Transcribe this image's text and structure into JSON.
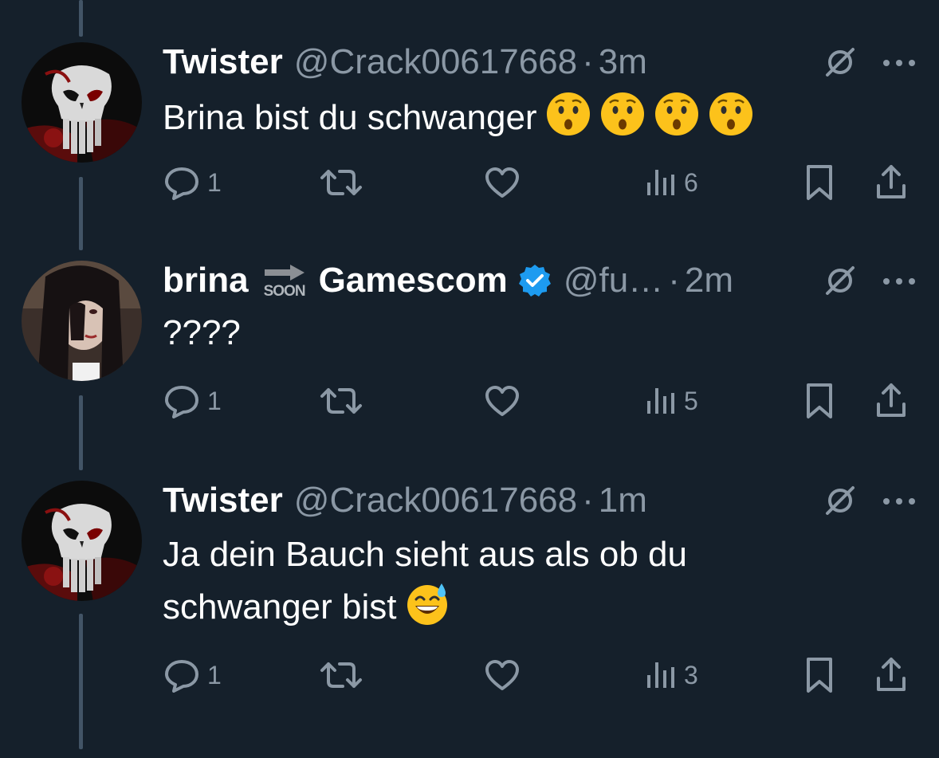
{
  "colors": {
    "background": "#15202b",
    "secondary_text": "#8b98a5",
    "thread_line": "#425466",
    "verified_blue": "#1d9bf0"
  },
  "tweets": [
    {
      "name": "Twister",
      "handle": "@Crack00617668",
      "dot": "·",
      "time": "3m",
      "text": "Brina bist du schwanger",
      "emojis": [
        "hushed-face",
        "hushed-face",
        "hushed-face",
        "hushed-face"
      ],
      "avatar": "punisher-skull-avatar",
      "replies": "1",
      "retweets": "",
      "likes": "",
      "views": "6"
    },
    {
      "name": "brina",
      "name_suffix": "Gamescom",
      "badge_text": "SOON",
      "handle": "@fu…",
      "dot": "·",
      "time": "2m",
      "text": "????",
      "avatar": "dark-hair-girl-avatar",
      "replies": "1",
      "retweets": "",
      "likes": "",
      "views": "5"
    },
    {
      "name": "Twister",
      "handle": "@Crack00617668",
      "dot": "·",
      "time": "1m",
      "text": "Ja dein Bauch sieht aus als ob du\nschwanger bist",
      "emojis": [
        "grinning-sweat-face"
      ],
      "avatar": "punisher-skull-avatar",
      "replies": "1",
      "retweets": "",
      "likes": "",
      "views": "3"
    }
  ],
  "icons": {
    "reply": "reply-icon",
    "retweet": "retweet-icon",
    "like": "heart-icon",
    "views": "views-icon",
    "bookmark": "bookmark-icon",
    "share": "share-icon",
    "grok": "grok-icon",
    "more": "more-icon"
  }
}
